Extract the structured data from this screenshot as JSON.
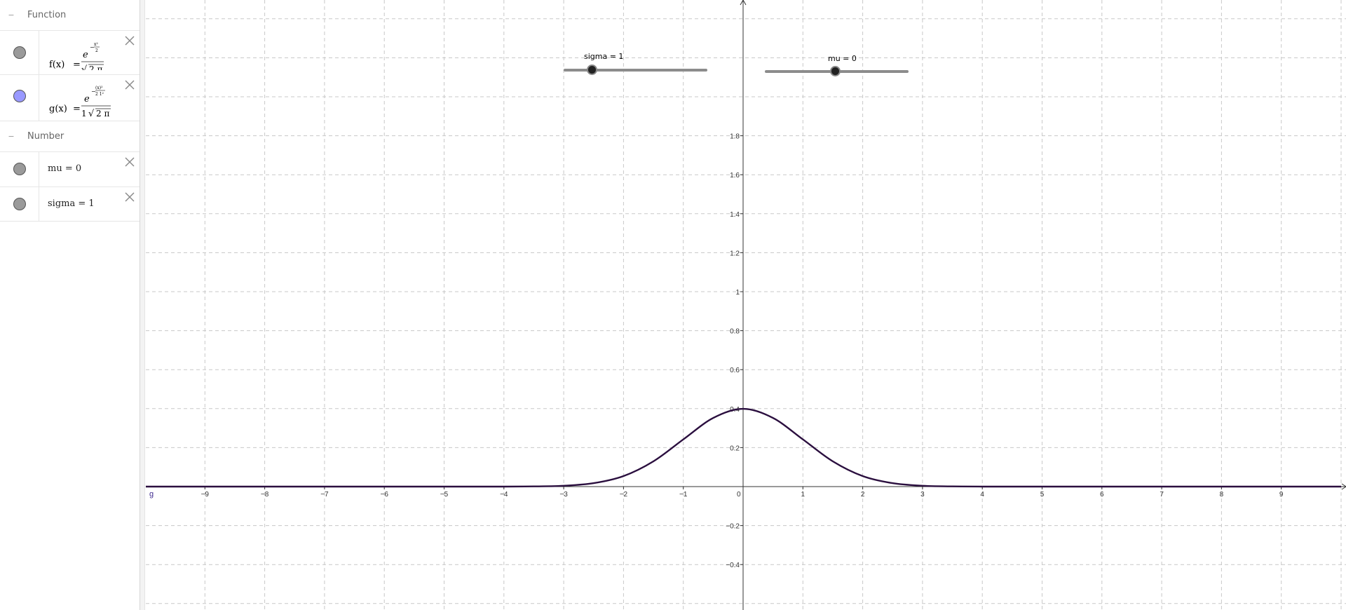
{
  "algebra": {
    "groups": [
      {
        "label": "Function",
        "items": [
          {
            "name": "f",
            "lhs": "f(x)",
            "marble_color": "#9a9a9a",
            "num_base": "e",
            "num_exp_sign": "−",
            "num_exp_top": "x²",
            "num_exp_bottom": "2",
            "den_prefix": "",
            "den_root": "√",
            "den_radicand": "2 π"
          },
          {
            "name": "g",
            "lhs": "g(x)",
            "marble_color": "#9999ff",
            "num_base": "e",
            "num_exp_sign": "−",
            "num_exp_top": "(x)²",
            "num_exp_bottom": "2 1²",
            "den_prefix": "1",
            "den_root": "√",
            "den_radicand": "2 π"
          }
        ]
      },
      {
        "label": "Number",
        "items": [
          {
            "name": "mu",
            "text": "mu = 0",
            "marble_color": "#9a9a9a"
          },
          {
            "name": "sigma",
            "text": "sigma = 1",
            "marble_color": "#9a9a9a"
          }
        ]
      }
    ]
  },
  "sliders": {
    "sigma": {
      "label": "sigma = 1",
      "value": 1,
      "min": 0,
      "max": 5
    },
    "mu": {
      "label": "mu = 0",
      "value": 0,
      "min": -5,
      "max": 5
    }
  },
  "chart_data": {
    "type": "line",
    "xlim": [
      -10,
      10
    ],
    "ylim": [
      -0.5,
      2
    ],
    "x_ticks": [
      -9,
      -8,
      -7,
      -6,
      -5,
      -4,
      -3,
      -2,
      -1,
      0,
      1,
      2,
      3,
      4,
      5,
      6,
      7,
      8,
      9
    ],
    "x_tick_labels": [
      "−9",
      "−8",
      "−7",
      "−6",
      "−5",
      "−4",
      "−3",
      "−2",
      "−1",
      "0",
      "1",
      "2",
      "3",
      "4",
      "5",
      "6",
      "7",
      "8",
      "9"
    ],
    "y_ticks": [
      -0.4,
      -0.2,
      0.2,
      0.4,
      0.6,
      0.8,
      1,
      1.2,
      1.4,
      1.6,
      1.8
    ],
    "y_tick_labels": [
      "−0.4",
      "−0.2",
      "0.2",
      "0.4",
      "0.6",
      "0.8",
      "1",
      "1.2",
      "1.4",
      "1.6",
      "1.8"
    ],
    "grid": true,
    "origin_label": "0",
    "curve_label": "g",
    "series": [
      {
        "color": "#2b0f3f",
        "x": [
          -10,
          -5,
          -4,
          -3.5,
          -3,
          -2.5,
          -2,
          -1.5,
          -1,
          -0.5,
          0,
          0.5,
          1,
          1.5,
          2,
          2.5,
          3,
          3.5,
          4,
          5,
          10
        ],
        "y": [
          0,
          0,
          0.0001,
          0.0009,
          0.0044,
          0.0175,
          0.054,
          0.1295,
          0.242,
          0.3521,
          0.3989,
          0.3521,
          0.242,
          0.1295,
          0.054,
          0.0175,
          0.0044,
          0.0009,
          0.0001,
          0,
          0
        ]
      }
    ]
  }
}
